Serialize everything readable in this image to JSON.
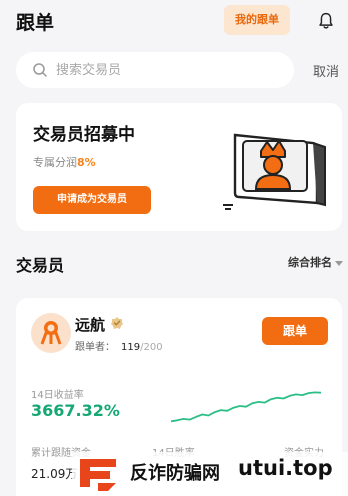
{
  "header": {
    "title": "跟单",
    "my_follow_label": "我的跟单",
    "notification_icon": "bell-icon"
  },
  "search": {
    "placeholder": "搜索交易员",
    "value": "",
    "cancel_label": "取消",
    "icon": "search-icon"
  },
  "recruit": {
    "title": "交易员招募中",
    "subtitle_prefix": "专属分润",
    "subtitle_percent": "8%",
    "apply_label": "申请成为交易员",
    "illustration_icon": "trader-crown-illustration"
  },
  "traders_section": {
    "title": "交易员",
    "sort_label": "综合排名"
  },
  "trader": {
    "name": "远航",
    "badge_icon": "verified-badge-icon",
    "followers_label": "跟单者：",
    "followers_current": "119",
    "followers_max": "/200",
    "follow_label": "跟单",
    "roi_label": "14日收益率",
    "roi_value": "3667.32%",
    "roi_trend": [
      0.05,
      0.08,
      0.12,
      0.1,
      0.18,
      0.25,
      0.22,
      0.32,
      0.38,
      0.36,
      0.45,
      0.5,
      0.48,
      0.58,
      0.62,
      0.6,
      0.7,
      0.74,
      0.72,
      0.8,
      0.84,
      0.82,
      0.88,
      0.9,
      0.89
    ],
    "stats": [
      {
        "label": "累计跟随资金",
        "value": "21.09万"
      },
      {
        "label": "14日胜率",
        "value": ""
      },
      {
        "label": "资金实力",
        "value": ""
      }
    ]
  },
  "watermark": {
    "text_cn": "反诈防骗网",
    "text_url": "utui.top"
  },
  "colors": {
    "accent": "#f26d12",
    "accent_soft": "#fde6cf",
    "positive": "#16a874"
  }
}
